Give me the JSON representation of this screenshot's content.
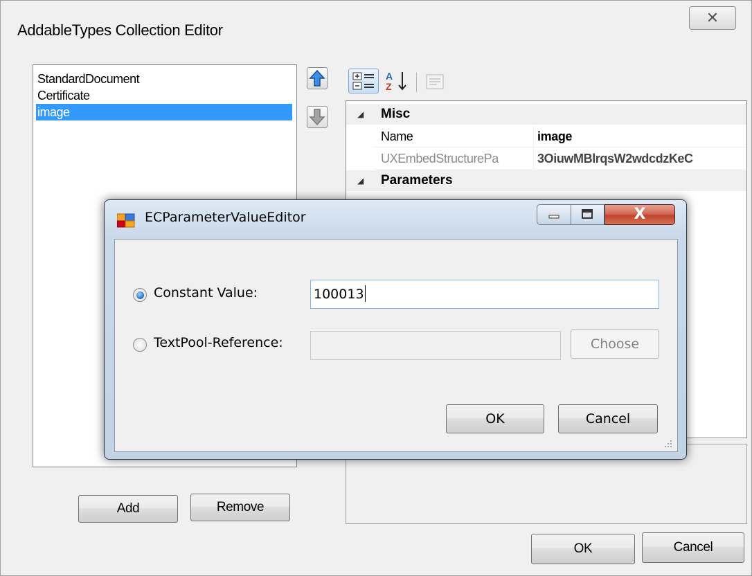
{
  "outer_window": {
    "title": "AddableTypes Collection Editor",
    "close_label": "✕",
    "members": [
      "StandardDocument",
      "Certificate",
      "image"
    ],
    "selected_index": 2,
    "buttons": {
      "add": "Add",
      "remove": "Remove",
      "ok": "OK",
      "cancel": "Cancel"
    }
  },
  "property_grid": {
    "categories": [
      {
        "name": "Misc",
        "properties": [
          {
            "name": "Name",
            "value": "image"
          },
          {
            "name": "UXEmbedStructurePa",
            "value": "3OiuwMBlrqsW2wdcdzKeC"
          }
        ]
      },
      {
        "name": "Parameters",
        "properties": []
      }
    ]
  },
  "dialog": {
    "title": "ECParameterValueEditor",
    "close_label": "X",
    "constant_label": "Constant Value:",
    "constant_value": "100013",
    "textpool_label": "TextPool-Reference:",
    "textpool_value": "",
    "choose_label": "Choose",
    "ok_label": "OK",
    "cancel_label": "Cancel",
    "selected_option": "constant"
  },
  "colors": {
    "selection": "#3399ff",
    "window_bg": "#f0f0f0",
    "close_red": "#c0432c"
  }
}
